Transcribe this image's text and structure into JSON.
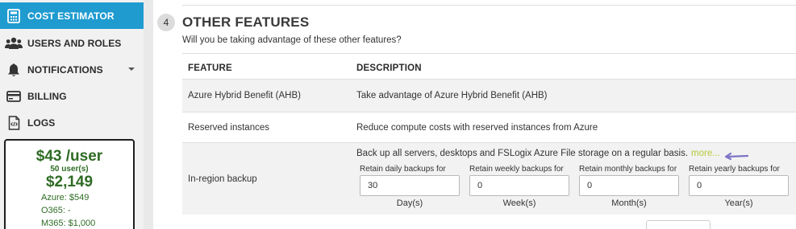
{
  "sidebar": {
    "items": [
      {
        "label": "COST ESTIMATOR",
        "icon": "calculator-icon"
      },
      {
        "label": "USERS AND ROLES",
        "icon": "users-icon"
      },
      {
        "label": "NOTIFICATIONS",
        "icon": "bell-icon"
      },
      {
        "label": "BILLING",
        "icon": "credit-card-icon"
      },
      {
        "label": "LOGS",
        "icon": "code-file-icon"
      }
    ],
    "active_color": "#1f9bd0"
  },
  "cost_summary": {
    "per_user": "$43 /user",
    "users": "50 user(s)",
    "total": "$2,149",
    "azure": "Azure: $549",
    "o365": "O365: -",
    "m365": "M365: $1,000"
  },
  "section": {
    "number": "4",
    "title": "OTHER FEATURES",
    "subtitle": "Will you be taking advantage of these other features?"
  },
  "table": {
    "headers": {
      "feature": "FEATURE",
      "description": "DESCRIPTION"
    },
    "rows": [
      {
        "feature": "Azure Hybrid Benefit (AHB)",
        "description": "Take advantage of Azure Hybrid Benefit (AHB)"
      },
      {
        "feature": "Reserved instances",
        "description": "Reduce compute costs with reserved instances from Azure"
      },
      {
        "feature": "In-region backup",
        "description": "Back up all servers, desktops and FSLogix Azure File storage on a regular basis.",
        "more": "more..."
      }
    ]
  },
  "backup": {
    "daily": {
      "label": "Retain daily backups for",
      "value": "30",
      "unit": "Day(s)"
    },
    "weekly": {
      "label": "Retain weekly backups for",
      "value": "0",
      "unit": "Week(s)"
    },
    "monthly": {
      "label": "Retain monthly backups for",
      "value": "0",
      "unit": "Month(s)"
    },
    "yearly": {
      "label": "Retain yearly backups for",
      "value": "0",
      "unit": "Year(s)"
    }
  }
}
